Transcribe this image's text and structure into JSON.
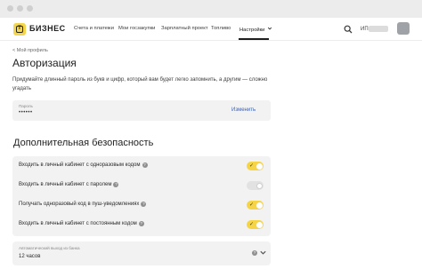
{
  "header": {
    "logo_glyph": "Т",
    "brand": "БИЗНЕС",
    "nav": [
      {
        "label": "Счета и платежи"
      },
      {
        "label": "Мои госзакупки"
      },
      {
        "label": "Зарплатный проект"
      },
      {
        "label": "Топливо"
      },
      {
        "label": "Настройки"
      }
    ],
    "user_label": "ИП"
  },
  "page": {
    "back_link": "< Мой профиль",
    "title": "Авторизация",
    "description": "Придумайте длинный пароль из букв и цифр, который вам будет легко запомнить, а другим — сложно угадать",
    "password": {
      "label": "Пароль",
      "value": "••••••",
      "change_label": "Изменить"
    }
  },
  "security": {
    "title": "Дополнительная безопасность",
    "rows": [
      {
        "label": "Входить в личный кабинет с одноразовым кодом",
        "enabled": true
      },
      {
        "label": "Входить в личный кабинет с паролем",
        "enabled": false
      },
      {
        "label": "Получать одноразовый код в пуш-уведомлениях",
        "enabled": true
      },
      {
        "label": "Входить в личный кабинет с постоянным кодом",
        "enabled": true
      }
    ],
    "auto_logout": {
      "label": "Автоматический выход из банка",
      "value": "12 часов"
    }
  },
  "colors": {
    "accent": "#f5d547",
    "link": "#3e62b0",
    "panel": "#f2f2f2"
  },
  "icons": {
    "search": "search-icon",
    "help": "help-icon",
    "chevron": "chevron-down-icon"
  }
}
